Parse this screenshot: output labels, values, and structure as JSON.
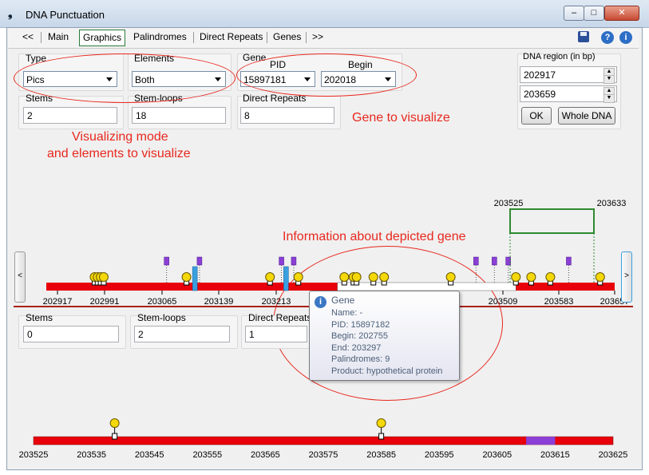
{
  "window": {
    "title": "DNA Punctuation"
  },
  "toolbar": {
    "tabs": [
      "<<",
      "Main",
      "Graphics",
      "Palindromes",
      "Direct Repeats",
      "Genes",
      ">>"
    ],
    "active_tab": "Graphics",
    "icons": [
      "save-icon",
      "help-icon",
      "info-icon"
    ]
  },
  "controls": {
    "type": {
      "label": "Type",
      "value": "Pics"
    },
    "elements": {
      "label": "Elements",
      "value": "Both"
    },
    "gene": {
      "label": "Gene",
      "pid_label": "PID",
      "begin_label": "Begin",
      "pid_value": "15897181",
      "begin_value": "202018"
    },
    "stems": {
      "label": "Stems",
      "value": "2"
    },
    "stem_loops": {
      "label": "Stem-loops",
      "value": "18"
    },
    "direct_repeats": {
      "label": "Direct Repeats",
      "value": "8"
    },
    "dna_region": {
      "label": "DNA region (in bp)",
      "start": "202917",
      "end": "203659",
      "ok_label": "OK",
      "whole_label": "Whole DNA"
    }
  },
  "annotations": {
    "visualizing_line1": "Visualizing mode",
    "visualizing_line2": "and elements to visualize",
    "gene_to_visualize": "Gene to visualize",
    "gene_info": "Information about depicted gene"
  },
  "chart_data": [
    {
      "type": "genome-track",
      "range": [
        202917,
        203659
      ],
      "tick_labels": [
        "202917",
        "202991",
        "203065",
        "203139",
        "203213",
        "203509",
        "203583",
        "203657"
      ],
      "stem_loop_positions": [
        202980,
        202984,
        202988,
        202992,
        203100,
        203209,
        203246,
        203306,
        203318,
        203322,
        203344,
        203358,
        203445,
        203530,
        203550,
        203575,
        203640
      ],
      "direct_repeat_positions": [
        203074,
        203117,
        203224,
        203240,
        203478,
        203502,
        203520,
        203599
      ],
      "stem_positions": [
        203111,
        203230
      ],
      "white_segment": [
        203297,
        203530
      ],
      "zoom_window": {
        "labels": [
          "203525",
          "203633"
        ]
      }
    },
    {
      "type": "genome-track",
      "range": [
        203525,
        203625
      ],
      "tick_labels": [
        "203525",
        "203535",
        "203545",
        "203555",
        "203565",
        "203575",
        "203585",
        "203595",
        "203605",
        "203615",
        "203625"
      ],
      "stem_loop_positions": [
        203539,
        203585
      ],
      "direct_repeat_segment": [
        203610,
        203615
      ]
    }
  ],
  "lower_counts": {
    "stems": {
      "label": "Stems",
      "value": "0"
    },
    "stem_loops": {
      "label": "Stem-loops",
      "value": "2"
    },
    "direct_repeats": {
      "label": "Direct Repeats",
      "value": "1"
    }
  },
  "tooltip": {
    "title": "Gene",
    "lines": [
      "Name: -",
      "PID: 15897182",
      "Begin: 202755",
      "End: 203297",
      "Palindromes: 9",
      "Product: hypothetical protein"
    ]
  },
  "nav": {
    "left": "<",
    "right": ">"
  },
  "colors": {
    "track": "#e8000a",
    "stem_loop": "#f5d80a",
    "direct_repeat": "#8b3fd6",
    "stem": "#3aa0e0",
    "annotation": "#e8281e",
    "zoom_box": "#2f8a2f"
  }
}
